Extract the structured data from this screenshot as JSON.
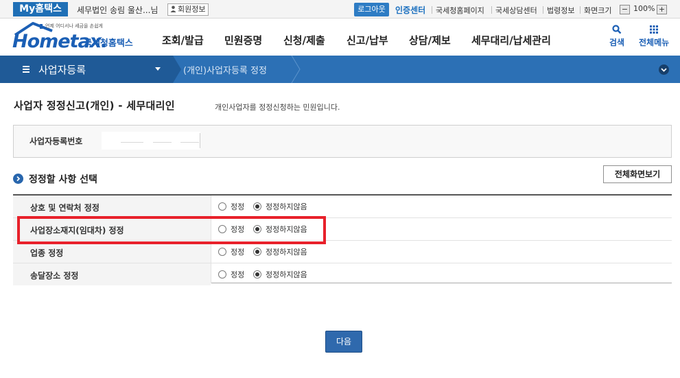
{
  "topbar": {
    "my_hometax": "My홈택스",
    "user_name": "세무법인 송림 울산...님",
    "member_info": "회원정보",
    "logout": "로그아웃",
    "cert_center": "인증센터",
    "links": [
      "국세청홈페이지",
      "국세상담센터",
      "법령정보",
      "화면크기"
    ],
    "zoom_minus": "−",
    "zoom_value": "100%",
    "zoom_plus": "+"
  },
  "header": {
    "logo_small": "언제 어디서나 세금을 손쉽게",
    "logo_text": "Hometax.",
    "logo_kor": "국세청홈택스",
    "gnb": [
      "조회/발급",
      "민원증명",
      "신청/제출",
      "신고/납부",
      "상담/제보",
      "세무대리/납세관리"
    ],
    "search": "검색",
    "all_menu": "전체메뉴",
    "search_icon": "search-icon",
    "menu_icon": "grid-menu-icon"
  },
  "location": {
    "menu": "사업자등록",
    "current": "(개인)사업자등록 정정"
  },
  "main": {
    "title": "사업자 정정신고(개인) - 세무대리인",
    "desc": "개인사업자를 정정신청하는 민원입니다.",
    "bizno_label": "사업자등록번호",
    "section_title": "정정할 사항 선택",
    "full_screen": "전체화면보기",
    "option_yes": "정정",
    "option_no": "정정하지않음",
    "rows": [
      {
        "label": "상호 및 연락처 정정",
        "selected": "no"
      },
      {
        "label": "사업장소재지(임대차) 정정",
        "selected": "no"
      },
      {
        "label": "업종 정정",
        "selected": "no"
      },
      {
        "label": "송달장소 정정",
        "selected": "no"
      }
    ],
    "next": "다음"
  },
  "colors": {
    "brand_blue": "#1b5fb5",
    "location_bar": "#2c70b5",
    "highlight_red": "#e8212b",
    "button_blue": "#2f69ad"
  }
}
